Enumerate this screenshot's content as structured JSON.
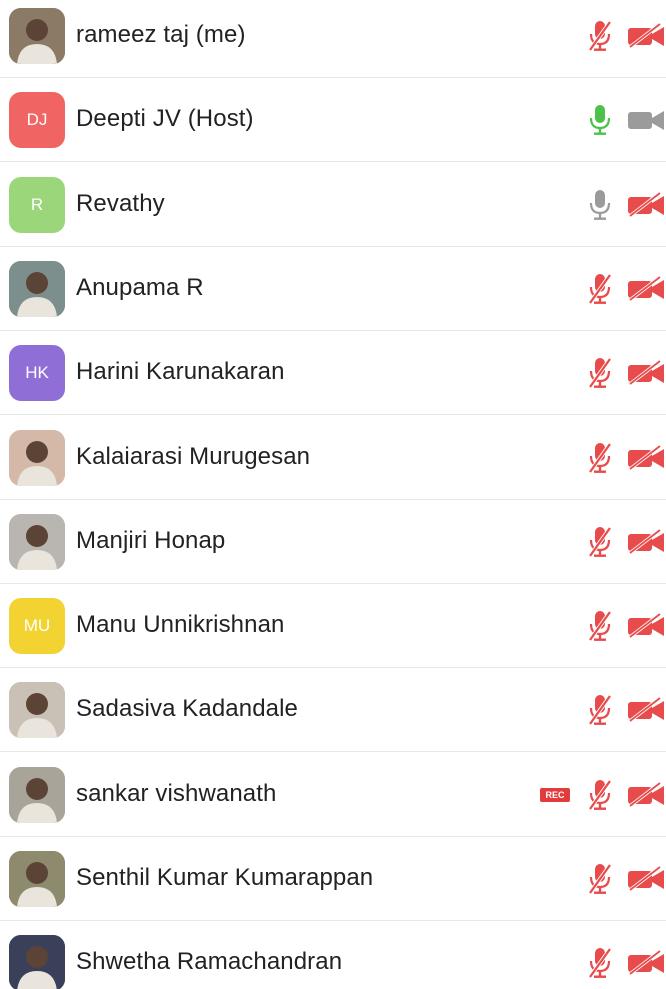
{
  "participants": [
    {
      "name": "rameez taj (me)",
      "avatar": {
        "type": "photo",
        "bg": "#8a7a66"
      },
      "mic": "muted",
      "video": "off",
      "rec": false
    },
    {
      "name": "Deepti JV (Host)",
      "avatar": {
        "type": "initials",
        "initials": "DJ",
        "bg": "#f06463"
      },
      "mic": "active",
      "video": "on",
      "rec": false
    },
    {
      "name": "Revathy",
      "avatar": {
        "type": "initials",
        "initials": "R",
        "bg": "#9bd77a"
      },
      "mic": "unmuted",
      "video": "off",
      "rec": false
    },
    {
      "name": "Anupama R",
      "avatar": {
        "type": "photo",
        "bg": "#7c8f8d"
      },
      "mic": "muted",
      "video": "off",
      "rec": false
    },
    {
      "name": "Harini Karunakaran",
      "avatar": {
        "type": "initials",
        "initials": "HK",
        "bg": "#8f6fd6"
      },
      "mic": "muted",
      "video": "off",
      "rec": false
    },
    {
      "name": "Kalaiarasi Murugesan",
      "avatar": {
        "type": "photo",
        "bg": "#d4b9a8"
      },
      "mic": "muted",
      "video": "off",
      "rec": false
    },
    {
      "name": "Manjiri Honap",
      "avatar": {
        "type": "photo",
        "bg": "#b9b6b2"
      },
      "mic": "muted",
      "video": "off",
      "rec": false
    },
    {
      "name": "Manu Unnikrishnan",
      "avatar": {
        "type": "initials",
        "initials": "MU",
        "bg": "#f3d332"
      },
      "mic": "muted",
      "video": "off",
      "rec": false
    },
    {
      "name": "Sadasiva Kadandale",
      "avatar": {
        "type": "photo",
        "bg": "#c9c0b6"
      },
      "mic": "muted",
      "video": "off",
      "rec": false
    },
    {
      "name": "sankar vishwanath",
      "avatar": {
        "type": "photo",
        "bg": "#a9a49a"
      },
      "mic": "muted",
      "video": "off",
      "rec": true,
      "rec_label": "REC"
    },
    {
      "name": "Senthil Kumar Kumarappan",
      "avatar": {
        "type": "photo",
        "bg": "#8d8a6e"
      },
      "mic": "muted",
      "video": "off",
      "rec": false
    },
    {
      "name": "Shwetha Ramachandran",
      "avatar": {
        "type": "photo",
        "bg": "#3a3f5a"
      },
      "mic": "muted",
      "video": "off",
      "rec": false
    }
  ],
  "colors": {
    "muted_red": "#e84b4b",
    "active_green": "#4cc24a",
    "idle_gray": "#9b9b9b",
    "separator": "#e8e8e8"
  }
}
